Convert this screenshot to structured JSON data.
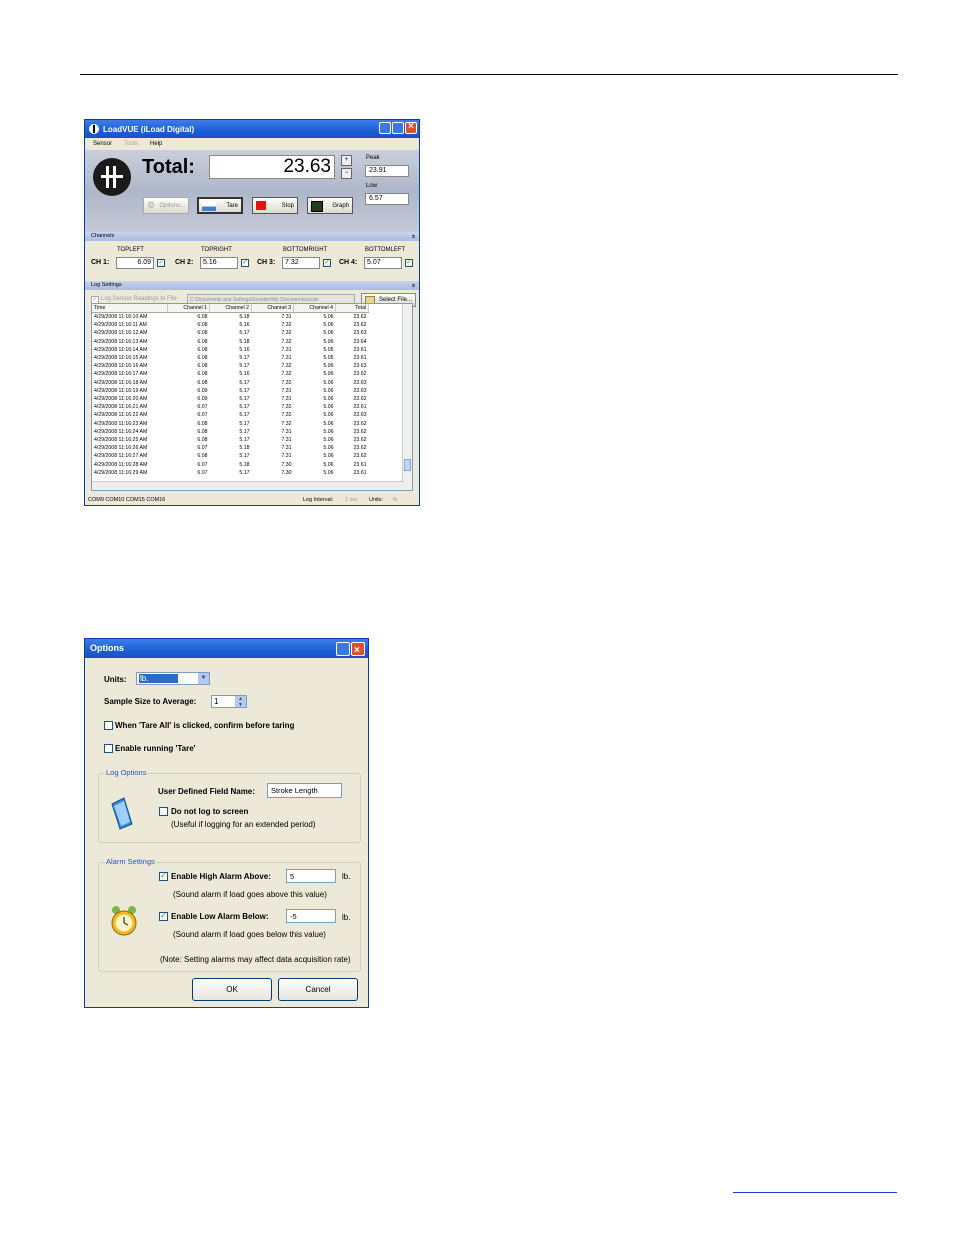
{
  "loadvue": {
    "title": "LoadVUE (iLoad Digital)",
    "menu": [
      "Sensor",
      "Tools",
      "Help"
    ],
    "total_label": "Total:",
    "total_value": "23.63",
    "peak_label": "Peak",
    "peak_value": "23.91",
    "low_label": "Low",
    "low_value": "6.57",
    "buttons": {
      "options": "Options...",
      "tare": "Tare",
      "stop": "Stop",
      "graph": "Graph"
    },
    "channels_header": "Channels",
    "channels": [
      {
        "name": "TOPLEFT",
        "label": "CH 1:",
        "value": "6.09"
      },
      {
        "name": "TOPRIGHT",
        "label": "CH 2:",
        "value": "5.16"
      },
      {
        "name": "BOTTOMRIGHT",
        "label": "CH 3:",
        "value": "7.32"
      },
      {
        "name": "BOTTOMLEFT",
        "label": "CH 4:",
        "value": "5.07"
      }
    ],
    "log_header": "Log Settings",
    "log_to_file_label": "Log Sensor Readings to File",
    "log_path": "C:\\Documents and Settings\\Scunder\\My Documents\\ocals",
    "select_file": "Select File...",
    "columns": [
      "Time",
      "Channel 1",
      "Channel 2",
      "Channel 3",
      "Channel 4",
      "Total"
    ],
    "rows": [
      [
        "4/29/2008 11:16:10 AM",
        "6.08",
        "5.18",
        "7.31",
        "5.06",
        "23.62"
      ],
      [
        "4/29/2008 11:16:11 AM",
        "6.08",
        "5.16",
        "7.32",
        "5.06",
        "23.62"
      ],
      [
        "4/29/2008 11:16:12 AM",
        "6.08",
        "5.17",
        "7.32",
        "5.06",
        "23.63"
      ],
      [
        "4/29/2008 11:16:13 AM",
        "6.08",
        "5.18",
        "7.32",
        "5.06",
        "23.64"
      ],
      [
        "4/29/2008 11:16:14 AM",
        "6.08",
        "5.16",
        "7.31",
        "5.05",
        "23.61"
      ],
      [
        "4/29/2008 11:16:15 AM",
        "6.08",
        "5.17",
        "7.31",
        "5.05",
        "23.61"
      ],
      [
        "4/29/2008 11:16:16 AM",
        "6.08",
        "5.17",
        "7.32",
        "5.06",
        "23.63"
      ],
      [
        "4/29/2008 11:16:17 AM",
        "6.08",
        "5.16",
        "7.32",
        "5.06",
        "23.62"
      ],
      [
        "4/29/2008 11:16:18 AM",
        "6.08",
        "5.17",
        "7.32",
        "5.06",
        "23.63"
      ],
      [
        "4/29/2008 11:16:19 AM",
        "6.09",
        "5.17",
        "7.31",
        "5.06",
        "23.63"
      ],
      [
        "4/29/2008 11:16:20 AM",
        "6.09",
        "5.17",
        "7.31",
        "5.06",
        "23.62"
      ],
      [
        "4/29/2008 11:16:21 AM",
        "6.07",
        "5.17",
        "7.32",
        "5.06",
        "23.61"
      ],
      [
        "4/29/2008 11:16:22 AM",
        "6.07",
        "5.17",
        "7.32",
        "5.06",
        "23.63"
      ],
      [
        "4/29/2008 11:16:23 AM",
        "6.08",
        "5.17",
        "7.32",
        "5.06",
        "23.62"
      ],
      [
        "4/29/2008 11:16:24 AM",
        "6.08",
        "5.17",
        "7.31",
        "5.06",
        "23.62"
      ],
      [
        "4/29/2008 11:16:25 AM",
        "6.08",
        "5.17",
        "7.31",
        "5.06",
        "23.62"
      ],
      [
        "4/29/2008 11:16:26 AM",
        "6.07",
        "5.18",
        "7.31",
        "5.06",
        "23.62"
      ],
      [
        "4/29/2008 11:16:27 AM",
        "6.08",
        "5.17",
        "7.31",
        "5.06",
        "23.62"
      ],
      [
        "4/29/2008 11:16:28 AM",
        "6.07",
        "5.18",
        "7.30",
        "5.06",
        "23.61"
      ],
      [
        "4/29/2008 11:16:29 AM",
        "6.07",
        "5.17",
        "7.30",
        "5.06",
        "23.61"
      ]
    ],
    "status_ports": "COM9  COM10  COM15  COM16",
    "log_interval_label": "Log Interval:",
    "log_interval_value": "1 sec",
    "units_label": "Units:",
    "units_value": "lb."
  },
  "options": {
    "title": "Options",
    "units_label": "Units:",
    "units_value": "lb.",
    "sample_label": "Sample Size to Average:",
    "sample_value": "1",
    "confirm_tare_label": "When 'Tare All' is clicked, confirm before taring",
    "running_tare_label": "Enable running 'Tare'",
    "log_options_title": "Log Options",
    "field_name_label": "User Defined Field Name:",
    "field_name_value": "Stroke Length",
    "no_log_label": "Do not log to screen",
    "no_log_note": "(Useful if logging for an extended period)",
    "alarm_title": "Alarm Settings",
    "high_alarm_label": "Enable High Alarm Above:",
    "high_alarm_value": "5",
    "high_alarm_note": "(Sound alarm if load goes above this value)",
    "low_alarm_label": "Enable Low Alarm Below:",
    "low_alarm_value": "-5",
    "low_alarm_note": "(Sound alarm if load goes below this value)",
    "unit_suffix": "lb.",
    "alarm_note": "(Note: Setting alarms may affect data acquisition rate)",
    "ok": "OK",
    "cancel": "Cancel"
  }
}
